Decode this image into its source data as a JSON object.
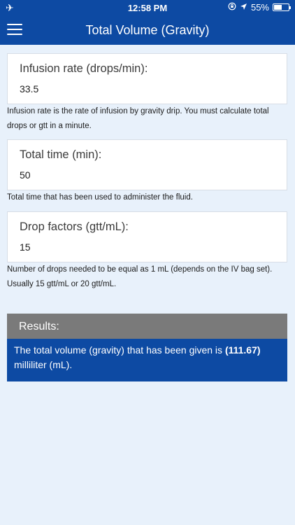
{
  "status_bar": {
    "time": "12:58 PM",
    "battery": "55%",
    "battery_level": 0.55,
    "icons": [
      "airplane-icon",
      "orientation-lock-icon",
      "location-arrow-icon",
      "battery-icon"
    ]
  },
  "header": {
    "title": "Total Volume (Gravity)",
    "menu_icon": "hamburger-menu-icon"
  },
  "fields": {
    "infusion_rate": {
      "label": "Infusion rate (drops/min):",
      "value": "33.5",
      "help": "Infusion rate is the rate of infusion by gravity drip. You must calculate total drops or gtt in a minute."
    },
    "total_time": {
      "label": "Total time (min):",
      "value": "50",
      "help": "Total time that has been used to administer the fluid."
    },
    "drop_factors": {
      "label": "Drop factors (gtt/mL):",
      "value": "15",
      "help": "Number of drops needed to be equal as 1 mL (depends on the IV bag set). Usually 15 gtt/mL or 20 gtt/mL."
    }
  },
  "results": {
    "header": "Results:",
    "text_prefix": "The total volume (gravity) that has been given is ",
    "value": "(111.67)",
    "text_suffix": " milliliter (mL)."
  },
  "colors": {
    "primary": "#0d4aa3",
    "background": "#e8f1fb",
    "results_header": "#7a7a7a"
  }
}
